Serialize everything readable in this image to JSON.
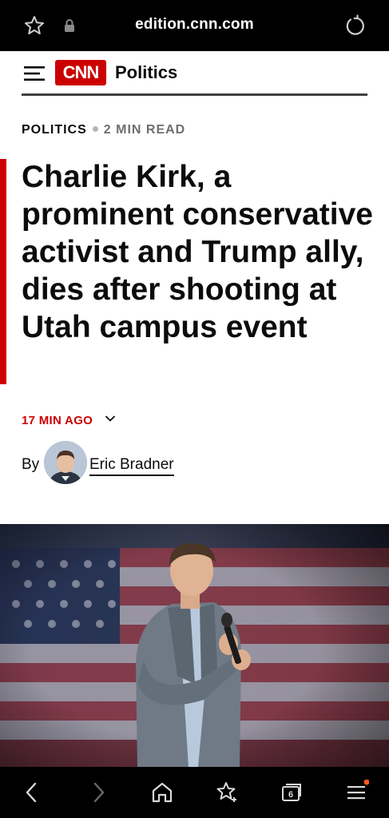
{
  "browser": {
    "url": "edition.cnn.com",
    "icons": [
      "star-icon",
      "lock-icon",
      "reload-icon"
    ],
    "tab_count": "6"
  },
  "cnn_header": {
    "logo_text": "CNN",
    "section": "Politics",
    "brand_color": "#cc0000"
  },
  "article": {
    "category": "POLITICS",
    "read_time": "2 MIN READ",
    "headline": "Charlie Kirk, a prominent conservative activist and Trump ally, dies after shooting at Utah campus event",
    "timestamp": "17 MIN AGO",
    "by_label": "By",
    "author": "Eric Bradner"
  },
  "bottom_nav": {
    "items": [
      "back-icon",
      "forward-icon",
      "home-icon",
      "favorites-icon",
      "tabs-icon",
      "menu-icon"
    ]
  }
}
